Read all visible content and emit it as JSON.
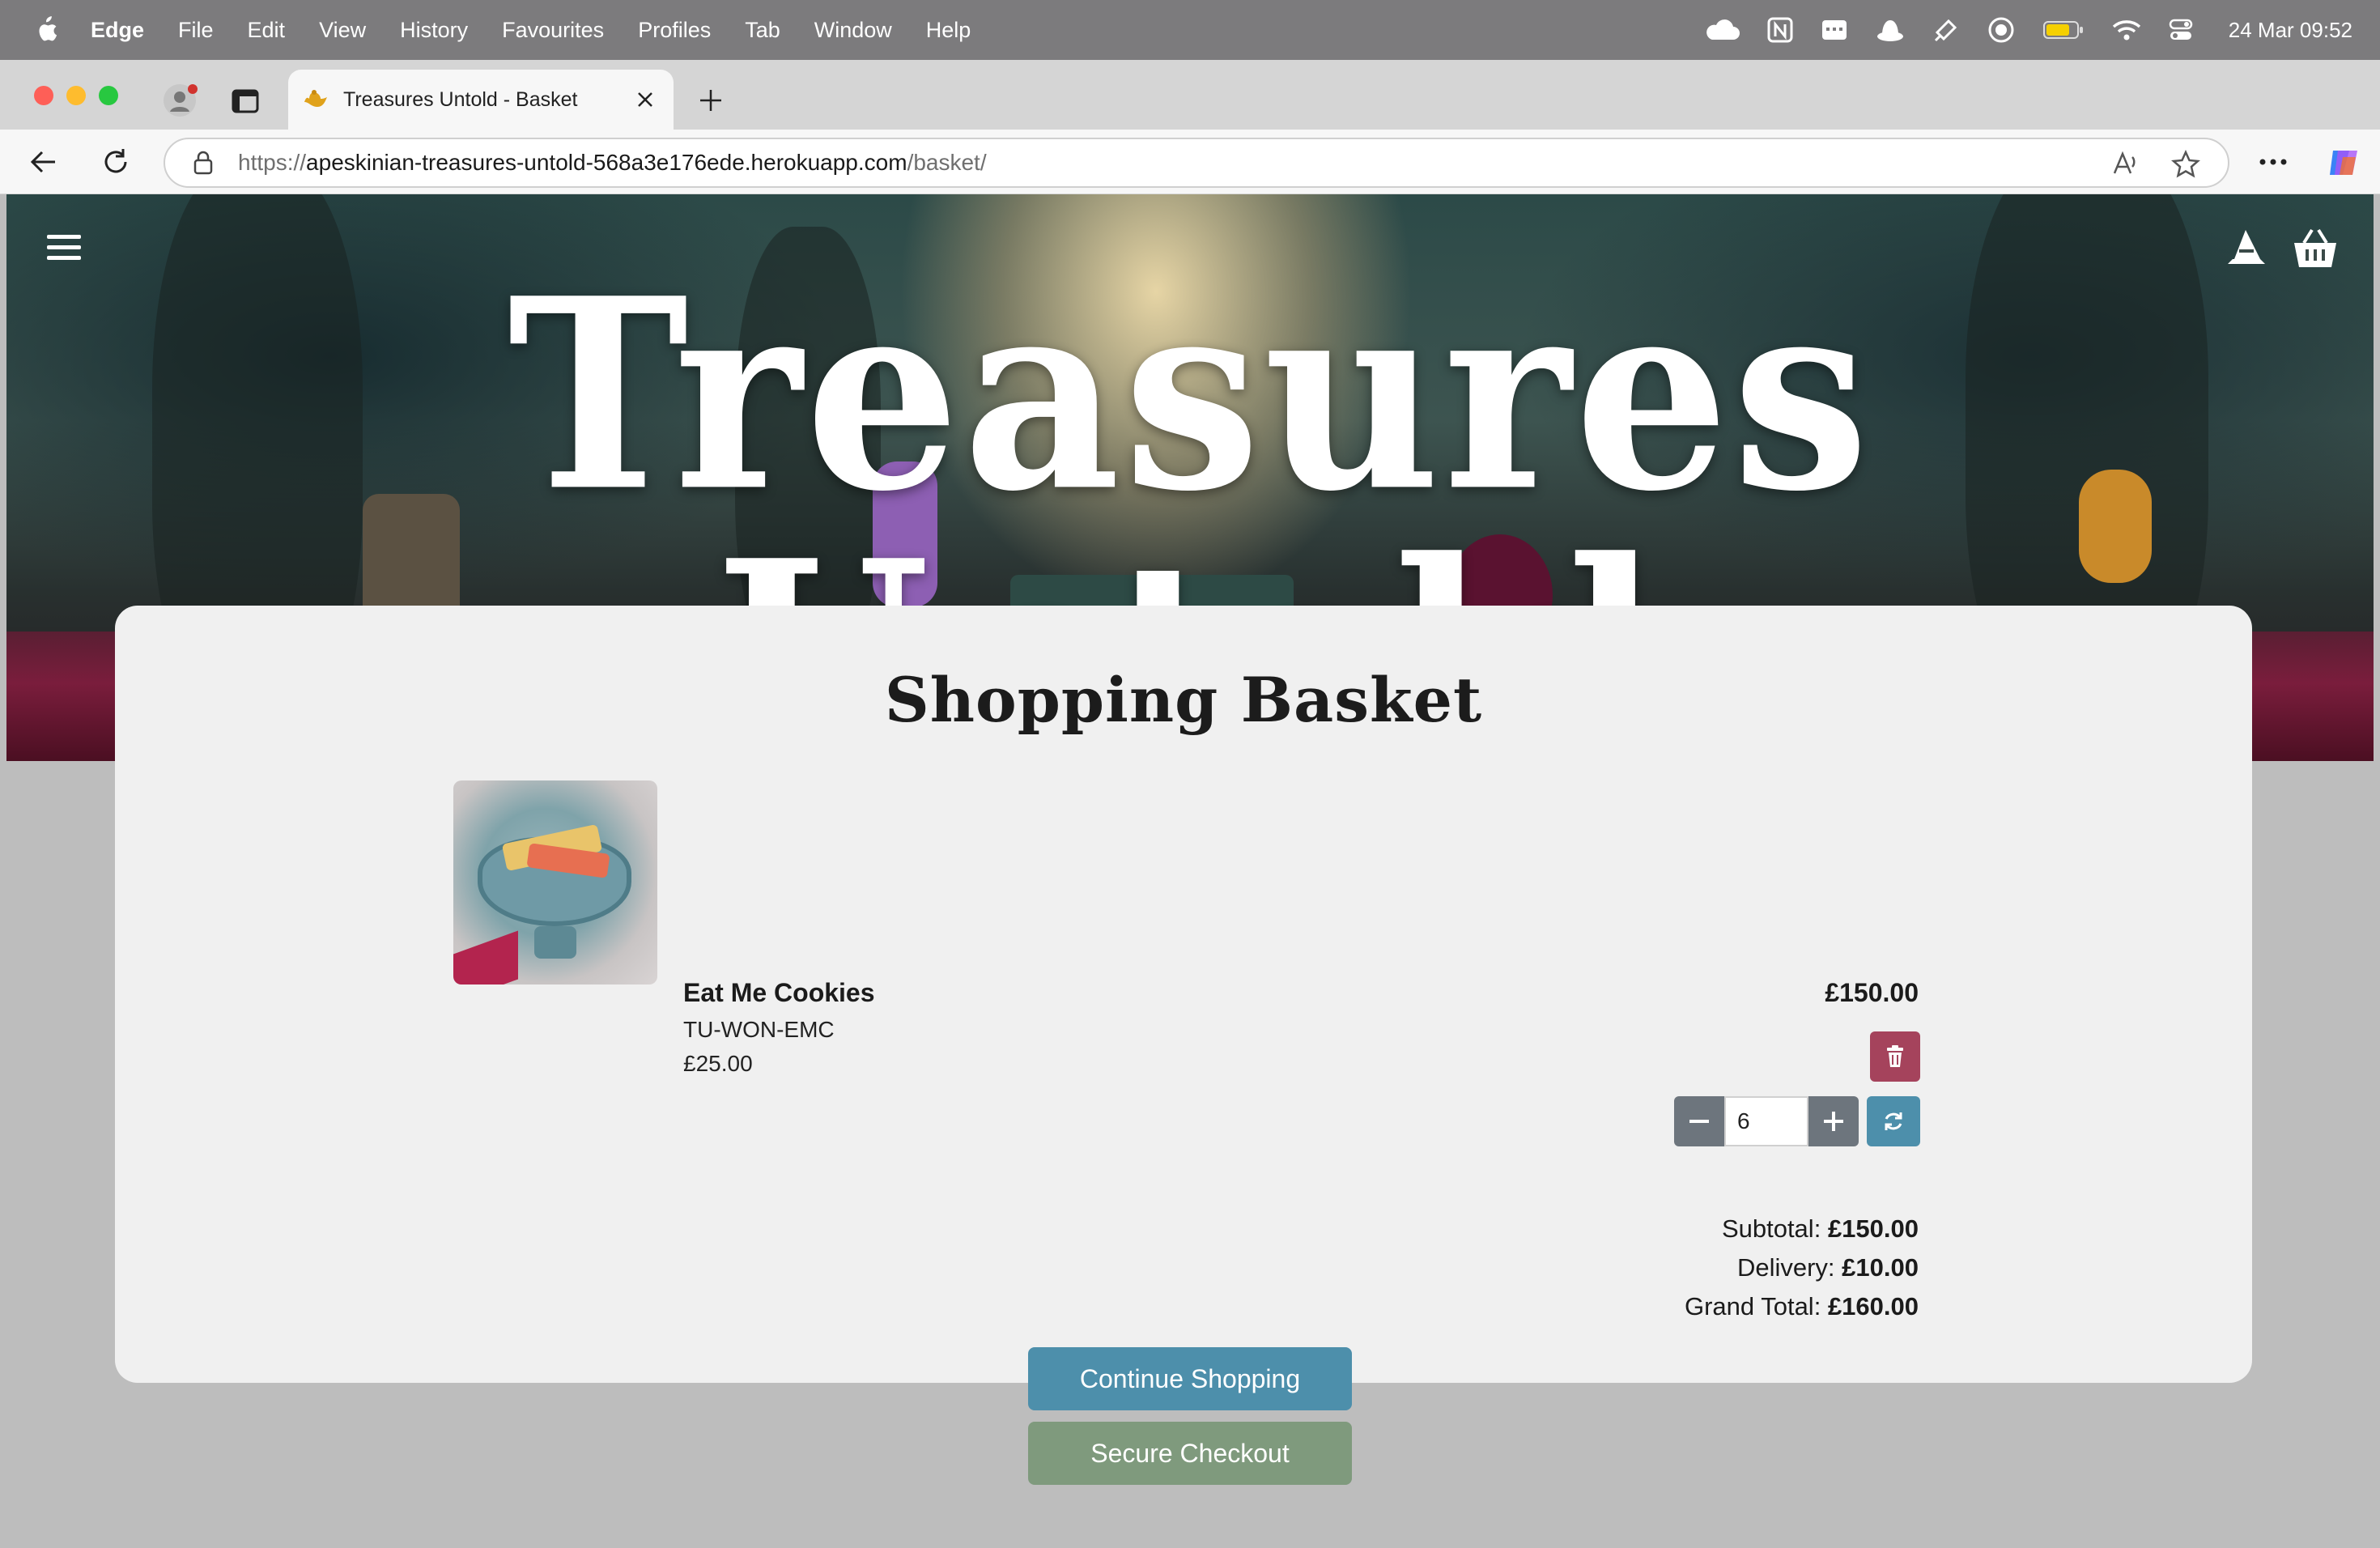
{
  "menubar": {
    "app_name": "Edge",
    "items": [
      "File",
      "Edit",
      "View",
      "History",
      "Favourites",
      "Profiles",
      "Tab",
      "Window",
      "Help"
    ],
    "clock": "24 Mar  09:52"
  },
  "browser": {
    "tab_title": "Treasures Untold - Basket",
    "url_scheme": "https://",
    "url_host": "apeskinian-treasures-untold-568a3e176ede.herokuapp.com",
    "url_path": "/basket/"
  },
  "site": {
    "title": "Treasures Untold"
  },
  "basket": {
    "heading": "Shopping Basket",
    "item": {
      "name": "Eat Me Cookies",
      "sku": "TU-WON-EMC",
      "price": "£25.00",
      "line_total": "£150.00",
      "quantity": "6"
    },
    "totals": {
      "subtotal_label": "Subtotal:",
      "subtotal_value": "£150.00",
      "delivery_label": "Delivery:",
      "delivery_value": "£10.00",
      "grand_label": "Grand Total:",
      "grand_value": "£160.00"
    },
    "continue_label": "Continue Shopping",
    "checkout_label": "Secure Checkout"
  },
  "colors": {
    "primary_button": "#4d8fab",
    "checkout_button": "#7f9a7d",
    "delete_button": "#a5435c",
    "qty_button": "#6d757d"
  },
  "icons": {
    "menu": "hamburger-icon",
    "account": "wizard-hat-icon",
    "basket": "basket-icon",
    "delete": "trash-icon",
    "minus": "minus-icon",
    "plus": "plus-icon",
    "update": "refresh-icon"
  }
}
